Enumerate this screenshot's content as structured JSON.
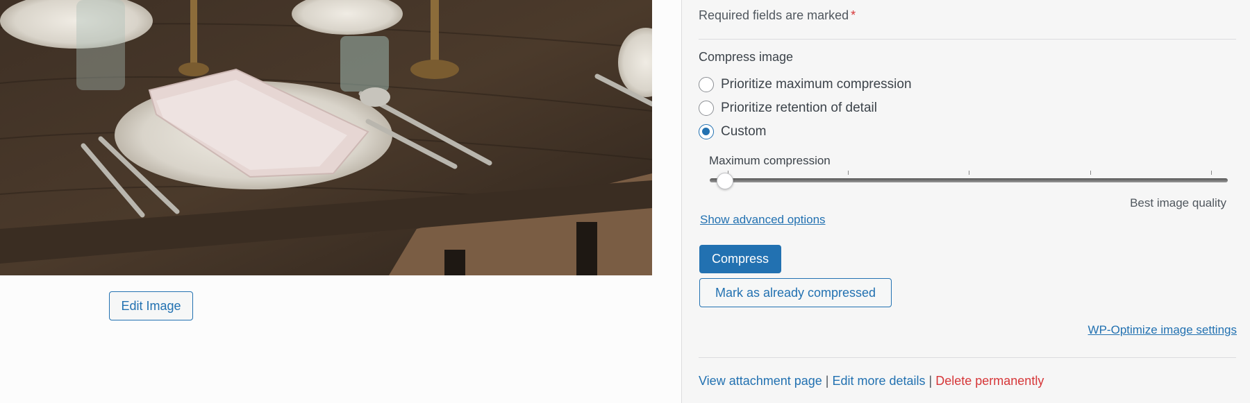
{
  "left": {
    "edit_image_label": "Edit Image"
  },
  "sidebar": {
    "required_text": "Required fields are marked",
    "required_star": "*",
    "compress_title": "Compress image",
    "options": [
      {
        "label": "Prioritize maximum compression",
        "checked": false
      },
      {
        "label": "Prioritize retention of detail",
        "checked": false
      },
      {
        "label": "Custom",
        "checked": true
      }
    ],
    "slider": {
      "label": "Maximum compression",
      "right_label": "Best image quality",
      "value_fraction": 0.02
    },
    "advanced_link": "Show advanced options",
    "compress_button": "Compress",
    "mark_compressed_button": "Mark as already compressed",
    "settings_link": "WP-Optimize image settings",
    "footer": {
      "view_attachment": "View attachment page",
      "edit_details": "Edit more details",
      "delete": "Delete permanently",
      "separator": "|"
    }
  },
  "colors": {
    "accent": "#2271b1",
    "danger": "#d63638"
  }
}
